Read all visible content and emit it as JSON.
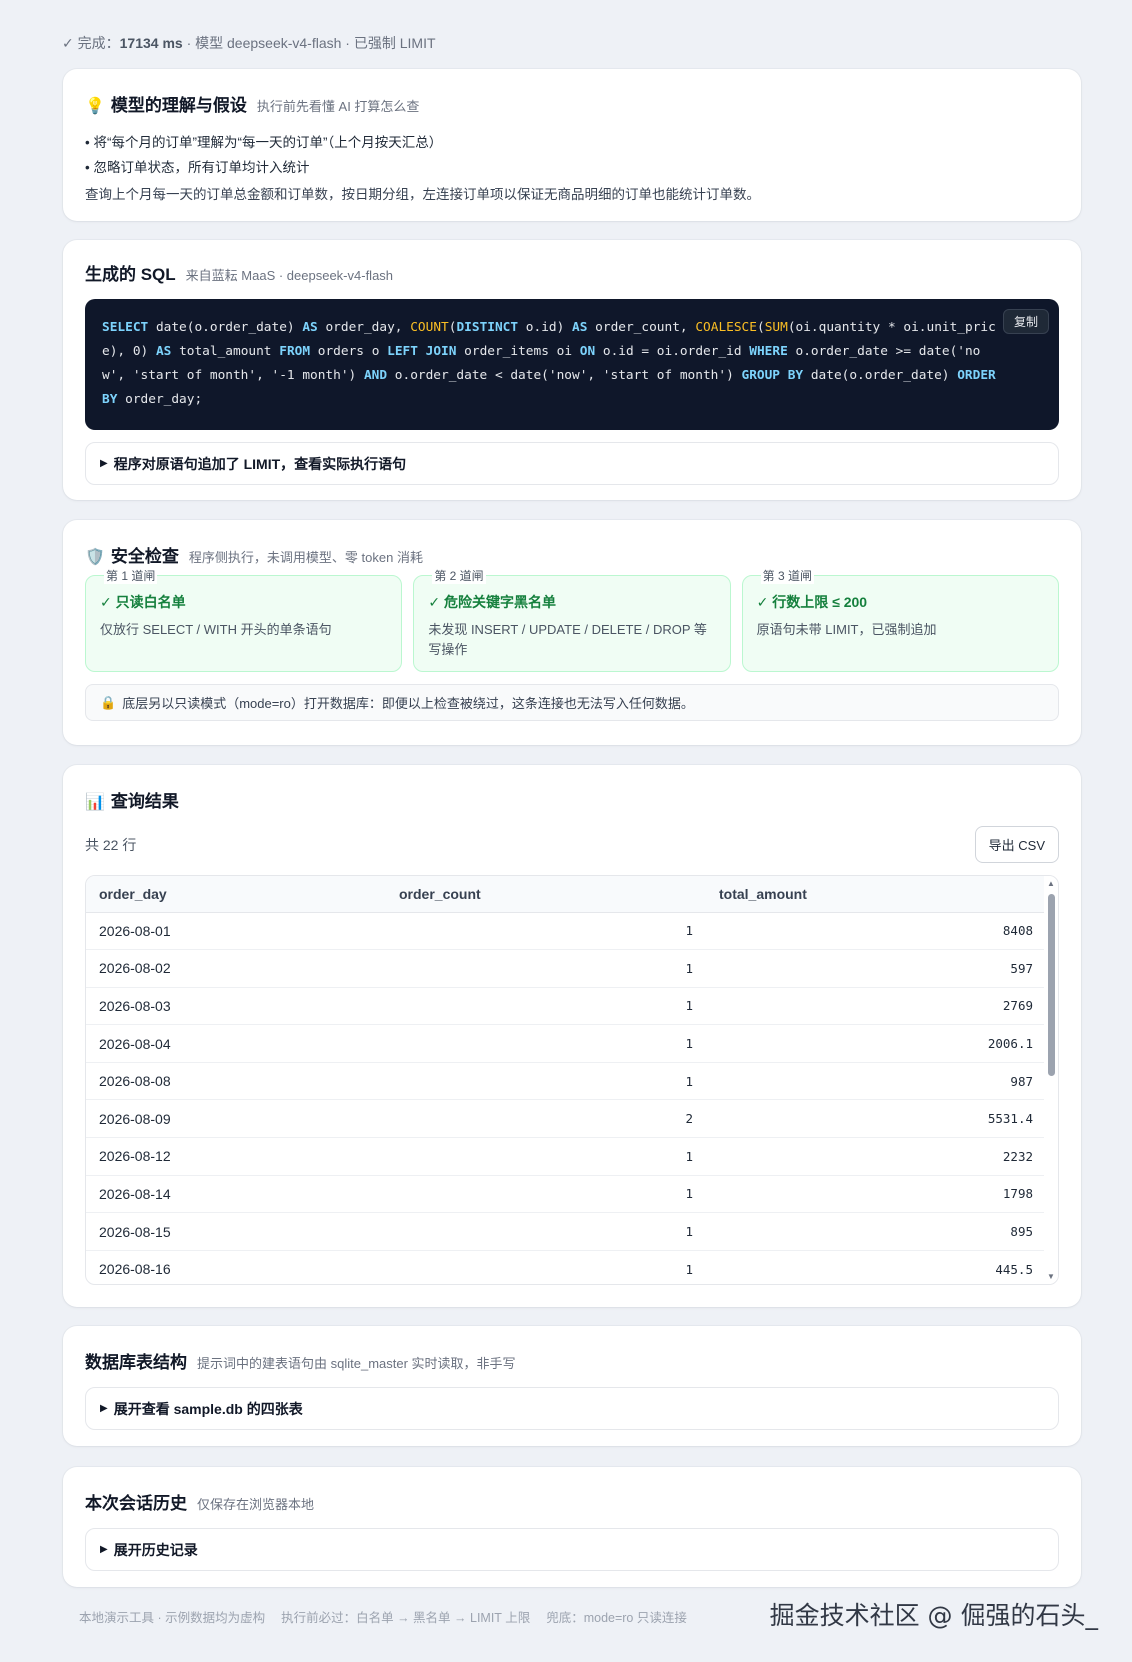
{
  "status": {
    "prefix": "✓ 完成：",
    "duration": "17134 ms",
    "suffix": " · 模型 deepseek-v4-flash · 已强制 LIMIT"
  },
  "understanding": {
    "icon": "lightbulb-icon",
    "title": "模型的理解与假设",
    "subtitle": "执行前先看懂 AI 打算怎么查",
    "assumptions": [
      "将“每个月的订单”理解为“每一天的订单”（上个月按天汇总）",
      "忽略订单状态，所有订单均计入统计"
    ],
    "description": "查询上个月每一天的订单总金额和订单数，按日期分组，左连接订单项以保证无商品明细的订单也能统计订单数。"
  },
  "sql": {
    "title": "生成的 SQL",
    "subtitle": "来自蓝耘 MaaS · deepseek-v4-flash",
    "copy_label": "复制",
    "limit_toggle": "程序对原语句追加了 LIMIT，查看实际执行语句",
    "tokens": [
      {
        "t": "SELECT",
        "c": "kw"
      },
      {
        "t": " date(o.order_date) ",
        "c": ""
      },
      {
        "t": "AS",
        "c": "kw"
      },
      {
        "t": " order_day, ",
        "c": ""
      },
      {
        "t": "COUNT",
        "c": "fn"
      },
      {
        "t": "(",
        "c": ""
      },
      {
        "t": "DISTINCT",
        "c": "kw"
      },
      {
        "t": " o.id) ",
        "c": ""
      },
      {
        "t": "AS",
        "c": "kw"
      },
      {
        "t": " order_count, ",
        "c": ""
      },
      {
        "t": "COALESCE",
        "c": "fn"
      },
      {
        "t": "(",
        "c": ""
      },
      {
        "t": "SUM",
        "c": "fn"
      },
      {
        "t": "(oi.quantity * oi.unit_price), 0) ",
        "c": ""
      },
      {
        "t": "AS",
        "c": "kw"
      },
      {
        "t": " total_amount ",
        "c": ""
      },
      {
        "t": "FROM",
        "c": "kw"
      },
      {
        "t": " orders o ",
        "c": ""
      },
      {
        "t": "LEFT JOIN",
        "c": "kw"
      },
      {
        "t": " order_items oi ",
        "c": ""
      },
      {
        "t": "ON",
        "c": "kw"
      },
      {
        "t": " o.id = oi.order_id ",
        "c": ""
      },
      {
        "t": "WHERE",
        "c": "kw"
      },
      {
        "t": " o.order_date >= date('now', 'start of month', '-1 month') ",
        "c": ""
      },
      {
        "t": "AND",
        "c": "kw"
      },
      {
        "t": " o.order_date < date('now', 'start of month') ",
        "c": ""
      },
      {
        "t": "GROUP BY",
        "c": "kw"
      },
      {
        "t": " date(o.order_date) ",
        "c": ""
      },
      {
        "t": "ORDER BY",
        "c": "kw"
      },
      {
        "t": " order_day;",
        "c": ""
      }
    ]
  },
  "security": {
    "icon": "shield-icon",
    "title": "安全检查",
    "subtitle": "程序侧执行，未调用模型、零 token 消耗",
    "gates": [
      {
        "tag": "第 1 道闸",
        "title": "✓ 只读白名单",
        "desc": "仅放行 SELECT / WITH 开头的单条语句"
      },
      {
        "tag": "第 2 道闸",
        "title": "✓ 危险关键字黑名单",
        "desc": "未发现 INSERT / UPDATE / DELETE / DROP 等写操作"
      },
      {
        "tag": "第 3 道闸",
        "title": "✓ 行数上限 ≤ 200",
        "desc": "原语句未带 LIMIT，已强制追加"
      }
    ],
    "readonly_icon": "lock-icon",
    "readonly_note": "底层另以只读模式（mode=ro）打开数据库：即便以上检查被绕过，这条连接也无法写入任何数据。"
  },
  "result": {
    "icon": "bar-chart-icon",
    "title": "查询结果",
    "row_count": "共 22 行",
    "export_label": "导出 CSV",
    "columns": [
      "order_day",
      "order_count",
      "total_amount"
    ],
    "rows": [
      [
        "2026-08-01",
        "1",
        "8408"
      ],
      [
        "2026-08-02",
        "1",
        "597"
      ],
      [
        "2026-08-03",
        "1",
        "2769"
      ],
      [
        "2026-08-04",
        "1",
        "2006.1"
      ],
      [
        "2026-08-08",
        "1",
        "987"
      ],
      [
        "2026-08-09",
        "2",
        "5531.4"
      ],
      [
        "2026-08-12",
        "1",
        "2232"
      ],
      [
        "2026-08-14",
        "1",
        "1798"
      ],
      [
        "2026-08-15",
        "1",
        "895"
      ],
      [
        "2026-08-16",
        "1",
        "445.5"
      ]
    ]
  },
  "schema": {
    "title": "数据库表结构",
    "subtitle": "提示词中的建表语句由 sqlite_master 实时读取，非手写",
    "toggle": "展开查看 sample.db 的四张表"
  },
  "history": {
    "title": "本次会话历史",
    "subtitle": "仅保存在浏览器本地",
    "toggle": "展开历史记录"
  },
  "footer": {
    "items": [
      "本地演示工具 · 示例数据均为虚构",
      "执行前必过：白名单 → 黑名单 → LIMIT 上限",
      "兜底：mode=ro 只读连接"
    ]
  },
  "watermark": "掘金技术社区 @ 倔强的石头_"
}
